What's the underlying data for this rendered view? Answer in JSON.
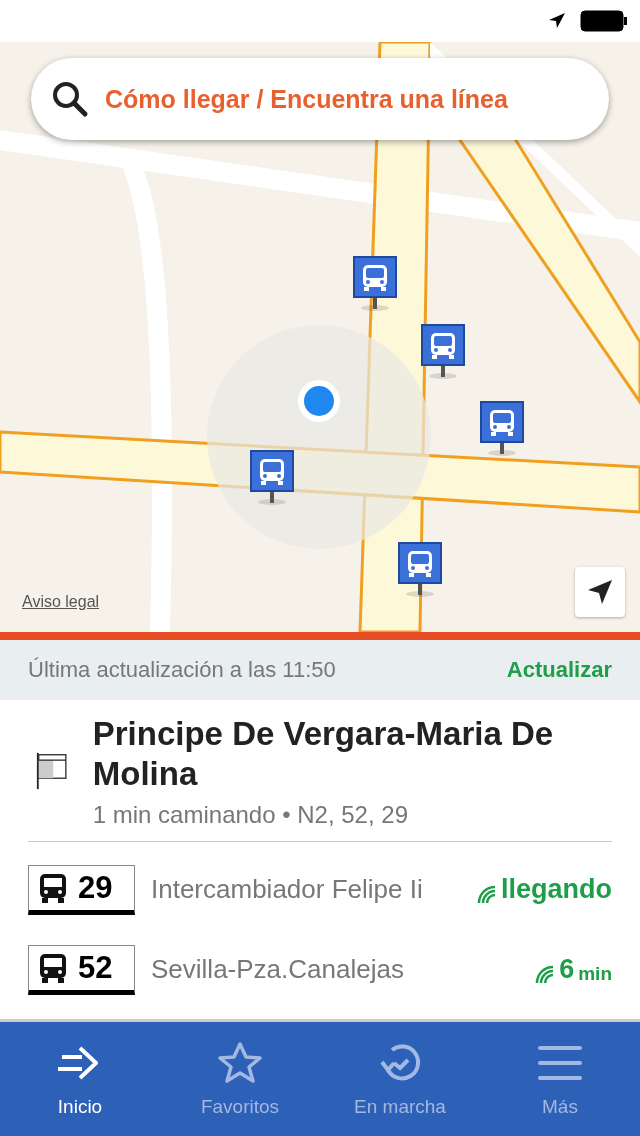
{
  "search": {
    "placeholder": "Cómo llegar / Encuentra una línea"
  },
  "map": {
    "kind": "picture",
    "legal_link": "Aviso legal"
  },
  "update_bar": {
    "text": "Última actualización a las 11:50",
    "action": "Actualizar"
  },
  "stop": {
    "name": "Principe De Vergara-Maria De Molina",
    "subtitle": "1 min caminando • N2, 52, 29"
  },
  "arrivals": [
    {
      "line": "29",
      "destination": "Intercambiador Felipe Ii",
      "eta": "llegando"
    },
    {
      "line": "52",
      "destination": "Sevilla-Pza.Canalejas",
      "eta": "6",
      "unit": "min"
    }
  ],
  "tabs": [
    {
      "label": "Inicio",
      "selected": true
    },
    {
      "label": "Favoritos",
      "selected": false
    },
    {
      "label": "En marcha",
      "selected": false
    },
    {
      "label": "Más",
      "selected": false
    }
  ]
}
